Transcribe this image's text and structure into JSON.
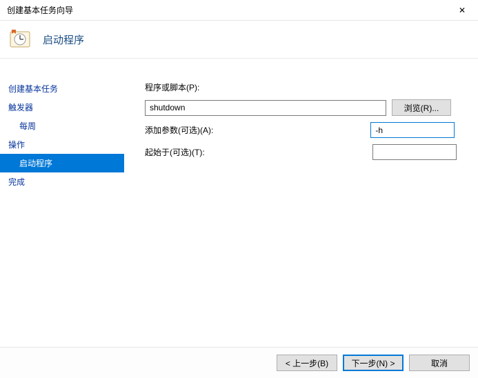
{
  "window": {
    "title": "创建基本任务向导",
    "close_symbol": "✕"
  },
  "header": {
    "title": "启动程序"
  },
  "sidebar": {
    "items": [
      {
        "label": "创建基本任务",
        "indent": false,
        "active": false
      },
      {
        "label": "触发器",
        "indent": false,
        "active": false
      },
      {
        "label": "每周",
        "indent": true,
        "active": false
      },
      {
        "label": "操作",
        "indent": false,
        "active": false
      },
      {
        "label": "启动程序",
        "indent": true,
        "active": true
      },
      {
        "label": "完成",
        "indent": false,
        "active": false
      }
    ]
  },
  "form": {
    "program_label": "程序或脚本(P):",
    "program_value": "shutdown",
    "browse_label": "浏览(R)...",
    "args_label": "添加参数(可选)(A):",
    "args_value": "-h",
    "startin_label": "起始于(可选)(T):",
    "startin_value": ""
  },
  "footer": {
    "back": "< 上一步(B)",
    "next": "下一步(N) >",
    "cancel": "取消"
  }
}
